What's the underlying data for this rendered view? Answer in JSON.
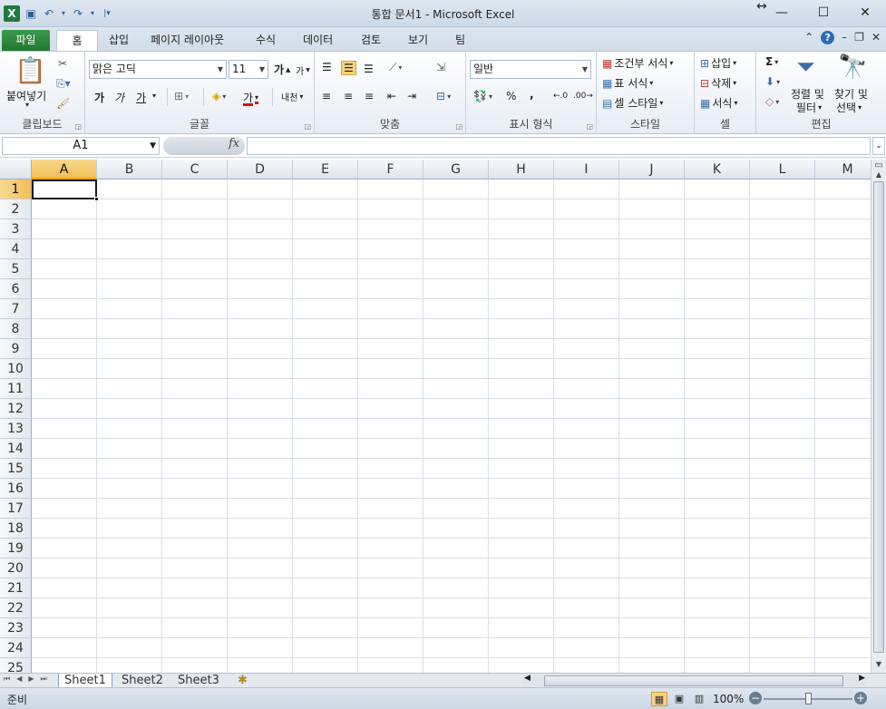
{
  "window": {
    "title": "통합 문서1 - Microsoft Excel",
    "controls": [
      "—",
      "☐",
      "✕"
    ]
  },
  "tabs": {
    "file": "파일",
    "home": "홈",
    "items": [
      "삽입",
      "페이지 레이아웃",
      "수식",
      "데이터",
      "검토",
      "보기",
      "팀"
    ]
  },
  "ribbon": {
    "clipboard": {
      "label": "클립보드",
      "paste": "붙여넣기"
    },
    "font": {
      "label": "글꼴",
      "name": "맑은 고딕",
      "size": "11",
      "bold": "가",
      "italic": "가",
      "underline": "가",
      "grow": "가",
      "shrink": "가",
      "color_a": "가",
      "phonetic": "내천"
    },
    "alignment": {
      "label": "맞춤"
    },
    "number": {
      "label": "표시 형식",
      "format": "일반",
      "percent": "%",
      "comma": ","
    },
    "styles": {
      "label": "스타일",
      "conditional": "조건부 서식",
      "table": "표 서식",
      "cell": "셀 스타일"
    },
    "cells": {
      "label": "셀",
      "insert": "삽입",
      "delete": "삭제",
      "format": "서식"
    },
    "editing": {
      "label": "편집",
      "sum": "Σ",
      "sort": "정렬 및",
      "sort2": "필터",
      "find": "찾기 및",
      "find2": "선택"
    }
  },
  "formula_bar": {
    "name_box": "A1",
    "fx": "fx",
    "formula": ""
  },
  "grid": {
    "columns": [
      "A",
      "B",
      "C",
      "D",
      "E",
      "F",
      "G",
      "H",
      "I",
      "J",
      "K",
      "L",
      "M"
    ],
    "rows": [
      "1",
      "2",
      "3",
      "4",
      "5",
      "6",
      "7",
      "8",
      "9",
      "10",
      "11",
      "12",
      "13",
      "14",
      "15",
      "16",
      "17",
      "18",
      "19",
      "20",
      "21",
      "22",
      "23",
      "24",
      "25"
    ]
  },
  "sheets": [
    "Sheet1",
    "Sheet2",
    "Sheet3"
  ],
  "status": {
    "ready": "준비",
    "zoom": "100%"
  }
}
